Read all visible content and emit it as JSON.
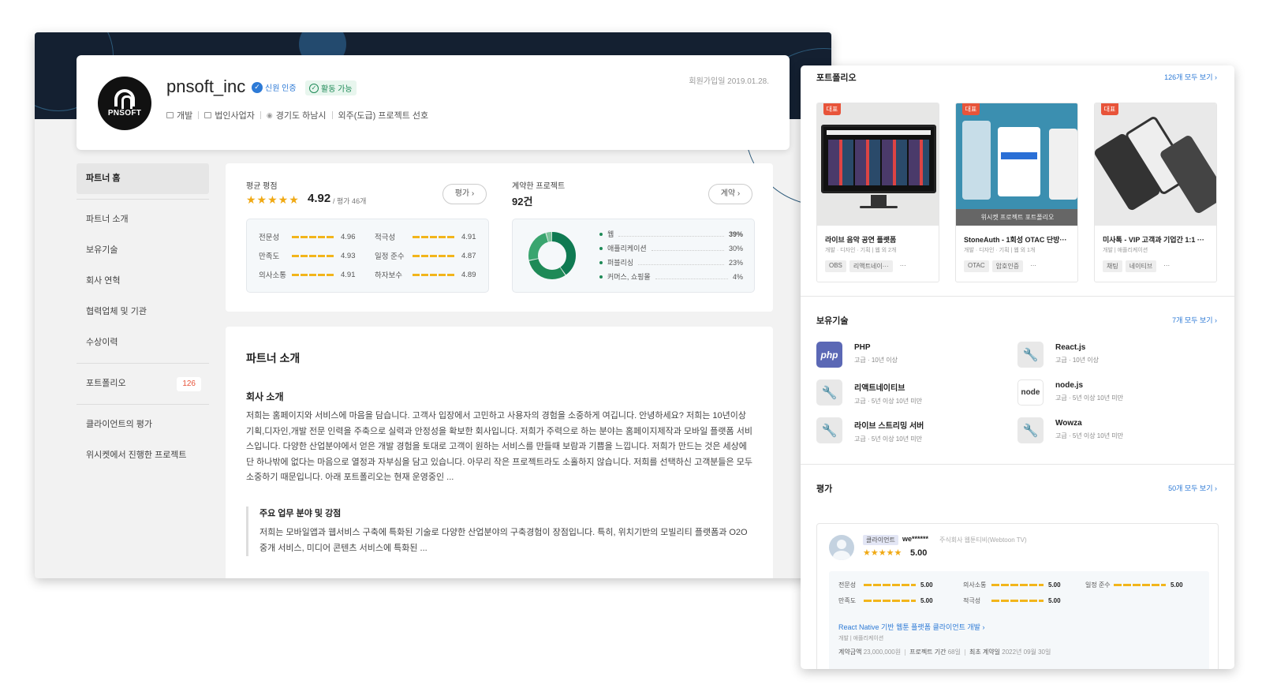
{
  "profile": {
    "name": "pnsoft_inc",
    "logo_text": "PNSOFT",
    "badge_verified": "신원 인증",
    "badge_active": "활동 가능",
    "category": "개발",
    "business_type": "법인사업자",
    "location": "경기도 하남시",
    "preference": "외주(도급) 프로젝트 선호",
    "joined": "회원가입일 2019.01.28."
  },
  "sidebar": {
    "items": [
      {
        "label": "파트너 홈"
      },
      {
        "label": "파트너 소개"
      },
      {
        "label": "보유기술"
      },
      {
        "label": "회사 연혁"
      },
      {
        "label": "협력업체 및 기관"
      },
      {
        "label": "수상이력"
      },
      {
        "label": "포트폴리오",
        "count": "126"
      },
      {
        "label": "클라이언트의 평가"
      },
      {
        "label": "위시켓에서 진행한 프로젝트"
      }
    ]
  },
  "rating": {
    "title": "평균 평점",
    "stars": "★★★★★",
    "avg": "4.92",
    "count": "/ 평가 46개",
    "button": "평가 ›",
    "metrics": [
      {
        "label": "전문성",
        "value": "4.96"
      },
      {
        "label": "적극성",
        "value": "4.91"
      },
      {
        "label": "만족도",
        "value": "4.93"
      },
      {
        "label": "일정 준수",
        "value": "4.87"
      },
      {
        "label": "의사소통",
        "value": "4.91"
      },
      {
        "label": "하자보수",
        "value": "4.89"
      }
    ]
  },
  "contracts": {
    "title": "계약한 프로젝트",
    "count": "92건",
    "button": "계약 ›",
    "breakdown": [
      {
        "label": "웹",
        "pct": "39%",
        "value": 39
      },
      {
        "label": "애플리케이션",
        "pct": "30%",
        "value": 30
      },
      {
        "label": "퍼블리싱",
        "pct": "23%",
        "value": 23
      },
      {
        "label": "커머스, 쇼핑몰",
        "pct": "4%",
        "value": 4
      }
    ]
  },
  "intro": {
    "heading": "파트너 소개",
    "subheading": "회사 소개",
    "body": "저희는 홈페이지와 서비스에 마음을 담습니다. 고객사 입장에서 고민하고 사용자의 경험을 소중하게 여깁니다. 안녕하세요? 저희는 10년이상 기획,디자인,개발 전문 인력을 주축으로 실력과 안정성을 확보한 회사입니다. 저희가 주력으로 하는 분야는 홈페이지제작과 모바일 플랫폼 서비스입니다. 다양한 산업분야에서 얻은 개발 경험을 토대로 고객이 원하는 서비스를 만들때 보람과 기쁨을 느낍니다. 저희가 만드는 것은 세상에 단 하나밖에 없다는 마음으로 열정과 자부심을 담고 있습니다. 아무리 작은 프로젝트라도 소홀하지 않습니다. 저희를 선택하신 고객분들은 모두 소중하기 때문입니다. 아래 포트폴리오는 현재 운영중인 ...",
    "strength_title": "주요 업무 분야 및 강점",
    "strength_body": "저희는 모바일앱과 웹서비스 구축에 특화된 기술로 다양한 산업분야의 구축경험이 장점입니다. 특히, 위치기반의 모빌리티 플랫폼과 O2O 중개 서비스, 미디어 콘텐츠 서비스에 특화된 ..."
  },
  "portfolio": {
    "title": "포트폴리오",
    "link": "126개 모두 보기 ›",
    "tag_label": "대표",
    "items": [
      {
        "title": "라이브 음악 공연 플랫폼",
        "sub": "개발 · 디자인 · 기획 | 웹 외 2개",
        "tags": [
          "OBS",
          "리액트네이···",
          "···"
        ]
      },
      {
        "title": "StoneAuth - 1회성 OTAC 단방···",
        "sub": "개발 · 디자인 · 기획 | 웹 외 1개",
        "tags": [
          "OTAC",
          "암호인증",
          "···"
        ],
        "overlay": "위시켓 프로젝트 포트폴리오"
      },
      {
        "title": "미사톡 - VIP 고객과 기업간 1:1 ···",
        "sub": "개발 | 애플리케이션",
        "tags": [
          "채팅",
          "네이티브",
          "···"
        ]
      }
    ]
  },
  "skills": {
    "title": "보유기술",
    "link": "7개 모두 보기 ›",
    "items": [
      {
        "name": "PHP",
        "level": "고급 · 10년 이상",
        "icon": "php-icon",
        "badge": "php"
      },
      {
        "name": "React.js",
        "level": "고급 · 10년 이상",
        "icon": "wrench-icon"
      },
      {
        "name": "리액트네이티브",
        "level": "고급 · 5년 이상 10년 미만",
        "icon": "wrench-icon"
      },
      {
        "name": "node.js",
        "level": "고급 · 5년 이상 10년 미만",
        "icon": "nodejs-icon",
        "badge": "node"
      },
      {
        "name": "라이브 스트리밍 서버",
        "level": "고급 · 5년 이상 10년 미만",
        "icon": "wrench-icon"
      },
      {
        "name": "Wowza",
        "level": "고급 · 5년 이상 10년 미만",
        "icon": "wrench-icon"
      }
    ]
  },
  "reviews": {
    "title": "평가",
    "link": "50개 모두 보기 ›",
    "item": {
      "role": "클라이언트",
      "user": "we******",
      "company": "주식회사 웹툰티비(Webtoon TV)",
      "stars": "★★★★★",
      "score": "5.00",
      "metrics": [
        {
          "label": "전문성",
          "value": "5.00"
        },
        {
          "label": "의사소통",
          "value": "5.00"
        },
        {
          "label": "일정 준수",
          "value": "5.00"
        },
        {
          "label": "만족도",
          "value": "5.00"
        },
        {
          "label": "적극성",
          "value": "5.00"
        }
      ],
      "project": "React Native 기반 웹툰 플랫폼 클라이언트 개발 ›",
      "category": "개발 | 애플리케이션",
      "amount_label": "계약금액",
      "amount": "23,000,000원",
      "period_label": "프로젝트 기간",
      "period": "68일",
      "date_label": "최초 계약일",
      "date": "2022년 09월 30일"
    }
  }
}
